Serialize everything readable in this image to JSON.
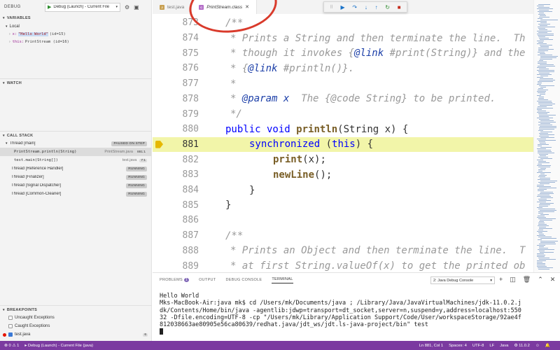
{
  "sidebar": {
    "title": "DEBUG",
    "config_label": "Debug (Launch) - Current File",
    "sections": {
      "variables": "VARIABLES",
      "local": "Local",
      "watch": "WATCH",
      "call_stack": "CALL STACK",
      "breakpoints": "BREAKPOINTS"
    },
    "variables": [
      {
        "name": "x:",
        "value": "\"Hello World\"",
        "extra": "(id=15)"
      },
      {
        "name": "this:",
        "value": "PrintStream (id=16)"
      }
    ],
    "call_stack": {
      "main_thread": "Thread [main]",
      "main_status": "PAUSED ON STEP",
      "frames": [
        {
          "name": "PrintStream.println(String)",
          "source": "PrintStream.java",
          "line": "881:1"
        },
        {
          "name": "test.main(String[])",
          "source": "test.java",
          "line": "7:1"
        }
      ],
      "threads": [
        {
          "name": "Thread [Reference Handler]",
          "status": "RUNNING"
        },
        {
          "name": "Thread [Finalizer]",
          "status": "RUNNING"
        },
        {
          "name": "Thread [Signal Dispatcher]",
          "status": "RUNNING"
        },
        {
          "name": "Thread [Common-Cleaner]",
          "status": "RUNNING"
        }
      ]
    },
    "breakpoints": [
      {
        "label": "Uncaught Exceptions",
        "checked": false
      },
      {
        "label": "Caught Exceptions",
        "checked": false
      },
      {
        "label": "test.java",
        "checked": true,
        "count": "6"
      }
    ]
  },
  "tabs": [
    {
      "label": "test.java",
      "active": false
    },
    {
      "label": "PrintStream.class",
      "active": true
    }
  ],
  "editor": {
    "lines": [
      "873",
      "874",
      "875",
      "876",
      "877",
      "878",
      "879",
      "880",
      "881",
      "882",
      "883",
      "884",
      "885",
      "886",
      "887",
      "888",
      "889"
    ],
    "code": {
      "c873": "/**",
      "c874": "* Prints a String and then terminate the line.  Th",
      "c875a": "* though it invokes {",
      "c875b": "@link",
      "c875c": " #print(String)} and the",
      "c876a": "* {",
      "c876b": "@link",
      "c876c": " #println()}.",
      "c877": "*",
      "c878a": "* ",
      "c878b": "@param",
      "c878c": " x",
      "c878d": "  The {@code String} to be printed.",
      "c879": "*/",
      "c880a": "public void ",
      "c880b": "println",
      "c880c": "(String x) {",
      "c881a": "synchronized",
      "c881b": " (",
      "c881c": "this",
      "c881d": ") {",
      "c882a": "print",
      "c882b": "(x);",
      "c883a": "newLine",
      "c883b": "();",
      "c884": "}",
      "c885": "}",
      "c886": "",
      "c887": "/**",
      "c888": "* Prints an Object and then terminate the line.  T",
      "c889": "* at first String.valueOf(x) to get the printed ob"
    }
  },
  "panel": {
    "tabs": {
      "problems": "PROBLEMS",
      "problems_count": "1",
      "output": "OUTPUT",
      "debug_console": "DEBUG CONSOLE",
      "terminal": "TERMINAL"
    },
    "console_select": "2: Java Debug Console",
    "terminal_lines": [
      "Hello World",
      "Mks-MacBook-Air:java mk$ cd /Users/mk/Documents/java ; /Library/Java/JavaVirtualMachines/jdk-11.0.2.j",
      "dk/Contents/Home/bin/java -agentlib:jdwp=transport=dt_socket,server=n,suspend=y,address=localhost:550",
      "32 -Dfile.encoding=UTF-8 -cp \"/Users/mk/Library/Application Support/Code/User/workspaceStorage/92ae4f",
      "812038663ae80905e56ca80639/redhat.java/jdt_ws/jdt.ls-java-project/bin\" test"
    ]
  },
  "statusbar": {
    "errors": "0",
    "warnings": "1",
    "debug_label": "Debug (Launch) - Current File (java)",
    "position": "Ln 881, Col 1",
    "spaces": "Spaces: 4",
    "encoding": "UTF-8",
    "eol": "LF",
    "language": "Java",
    "version": "11.0.2",
    "color": "#7b3aa0"
  }
}
